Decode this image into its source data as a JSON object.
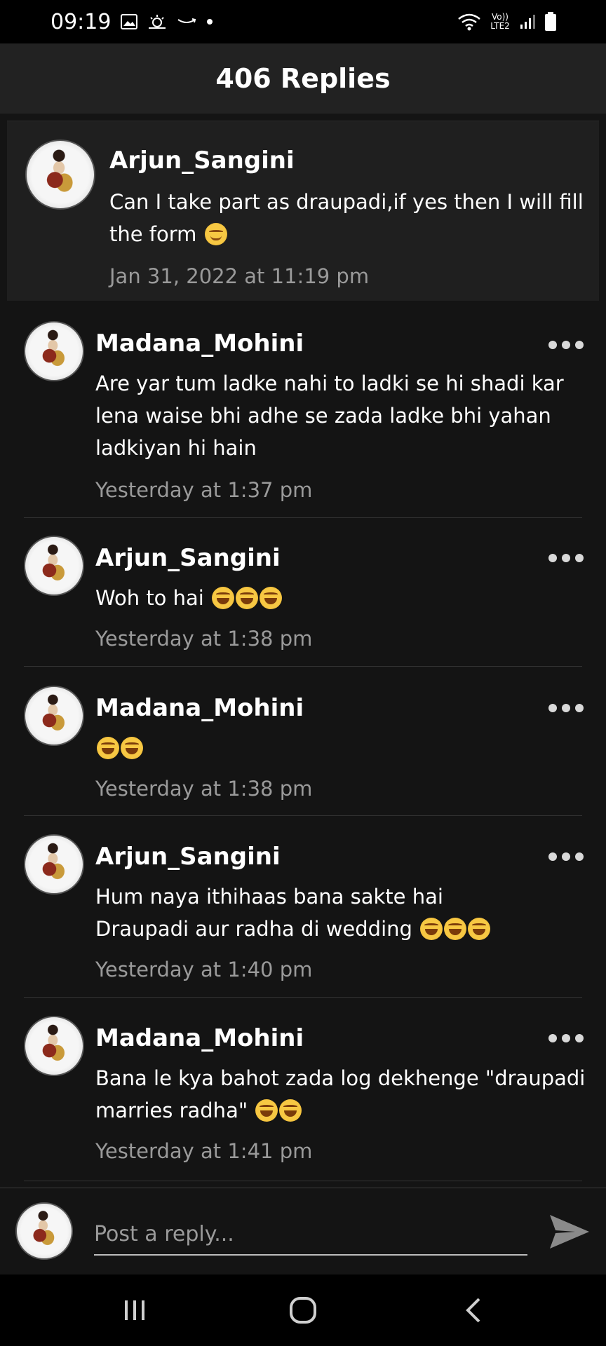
{
  "status_bar": {
    "time": "09:19",
    "network_label": "Vo)) LTE2"
  },
  "header": {
    "title": "406 Replies"
  },
  "parent": {
    "author": "Arjun_Sangini",
    "text": "Can I take part as draupadi,if yes then I will fill the form",
    "emoji": "smiling-face-emoji",
    "timestamp": "Jan 31, 2022 at 11:19 pm"
  },
  "replies": [
    {
      "author": "Madana_Mohini",
      "text": "Are yar tum ladke nahi to ladki se hi shadi kar lena waise bhi adhe se zada ladke bhi yahan ladkiyan hi hain",
      "emoji_count": 0,
      "timestamp": "Yesterday at 1:37 pm"
    },
    {
      "author": "Arjun_Sangini",
      "text": "Woh to hai",
      "emoji_count": 3,
      "timestamp": "Yesterday at 1:38 pm"
    },
    {
      "author": "Madana_Mohini",
      "text": "",
      "emoji_count": 2,
      "timestamp": "Yesterday at 1:38 pm"
    },
    {
      "author": "Arjun_Sangini",
      "text_line1": "Hum naya ithihaas bana sakte hai",
      "text_line2": "Draupadi aur radha di wedding",
      "emoji_count": 3,
      "timestamp": "Yesterday at 1:40 pm"
    },
    {
      "author": "Madana_Mohini",
      "text_line1": "Bana le kya bahot zada log dekhenge \"draupadi",
      "text_line2": "marries radha\"",
      "emoji_count": 2,
      "timestamp": "Yesterday at 1:41 pm"
    }
  ],
  "composer": {
    "placeholder": "Post a reply..."
  },
  "icons": {
    "more": "more-horizontal-icon",
    "send": "send-icon",
    "laugh_emoji": "face-with-tears-of-joy-emoji"
  },
  "colors": {
    "background": "#141414",
    "header": "#222222",
    "timestamp": "#9a9a9a"
  }
}
